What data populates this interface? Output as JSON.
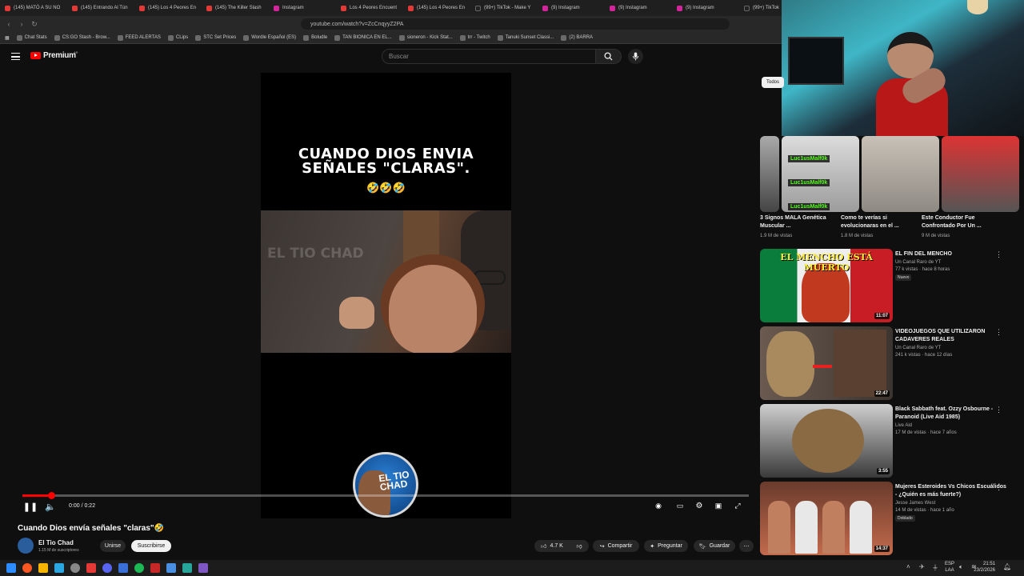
{
  "browser": {
    "tabs": [
      {
        "label": "(145) MATÓ A SU NO",
        "kind": "yt"
      },
      {
        "label": "(145) Entrando Al Tún",
        "kind": "yt"
      },
      {
        "label": "(145) Los 4 Peores En",
        "kind": "yt"
      },
      {
        "label": "(145) The Killer Slash",
        "kind": "yt"
      },
      {
        "label": "Instagram",
        "kind": "ig"
      },
      {
        "label": "Los 4 Peores Encuent",
        "kind": "yt"
      },
      {
        "label": "(145) Los 4 Peores En",
        "kind": "yt"
      },
      {
        "label": "(99+) TikTok - Make Y",
        "kind": "tt"
      },
      {
        "label": "(9) Instagram",
        "kind": "ig"
      },
      {
        "label": "(9) Instagram",
        "kind": "ig"
      },
      {
        "label": "(9) Instagram",
        "kind": "ig"
      },
      {
        "label": "(99+) TikTok",
        "kind": "tt"
      }
    ],
    "url": "youtube.com/watch?v=ZcCnqyyZ2PA",
    "bookmarks": [
      "Chat Stats",
      "CS:GO Stash - Brow...",
      "FEED ALERTAS",
      "CLips",
      "STC Set Prices",
      "Wordle Español (ES)",
      "Boludle",
      "TAN BIONICA EN EL...",
      "sioneron - Kick Stat...",
      "trr - Twitch",
      "Tanuki Sunset Classi...",
      "(2) BARRA"
    ]
  },
  "youtube": {
    "logo": "Premium",
    "logo_region": "AR",
    "search_placeholder": "Buscar",
    "chip": "Todos"
  },
  "player": {
    "caption_line1": "CUANDO DIOS ENVIA",
    "caption_line2": "SEÑALES \"CLARAS\".",
    "emojis": "🤣🤣🤣",
    "watermark": "EL TIO CHAD",
    "avatar_text": "EL TIO CHAD",
    "time": "0:00 / 0:22",
    "progress": 0.04
  },
  "video": {
    "title": "Cuando Dios envía señales \"claras\"🤣",
    "channel": "El Tio Chad",
    "subscribers": "1.15 M de suscriptores",
    "join_label": "Unirse",
    "subscribe_label": "Suscribirse",
    "likes": "4.7 K",
    "share_label": "Compartir",
    "ask_label": "Preguntar",
    "save_label": "Guardar"
  },
  "shorts": [
    {
      "title": "3 Signos MALA Genética Muscular ...",
      "views": "1.9 M de vistas"
    },
    {
      "title": "Como te verías si evolucionaras en el ...",
      "views": "1.8 M de vistas"
    },
    {
      "title": "Este Conductor Fue Confrontado Por Un ...",
      "views": "9 M de vistas"
    }
  ],
  "kick_overlay": "Luc1usMalf0k",
  "recommendations": [
    {
      "title": "EL FIN DEL MENCHO",
      "channel": "Un Canal Raro de YT",
      "meta": "77 k vistas · hace 8 horas",
      "badge": "Nuevo",
      "duration": "11:07",
      "thumb_text": "EL MENCHO ESTÁ MUERTO"
    },
    {
      "title": "VIDEOJUEGOS QUE UTILIZARON CADAVERES REALES",
      "channel": "Un Canal Raro de YT",
      "meta": "241 k vistas · hace 12 días",
      "badge": "",
      "duration": "22:47",
      "thumb_text": ""
    },
    {
      "title": "Black Sabbath feat. Ozzy Osbourne - Paranoid (Live Aid 1985)",
      "channel": "Live Aid",
      "meta": "17 M de vistas · hace 7 años",
      "badge": "",
      "duration": "3:55",
      "thumb_text": ""
    },
    {
      "title": "Mujeres Esteroides Vs Chicos Escuálidos - ¿Quién es más fuerte?)",
      "channel": "Jesse James West",
      "meta": "14 M de vistas · hace 1 año",
      "badge": "Doblado",
      "duration": "14:37",
      "thumb_text": ""
    }
  ],
  "taskbar": {
    "lang_line1": "ESP",
    "lang_line2": "LAA",
    "time": "21:51",
    "date": "23/2/2026"
  },
  "colors": {
    "accent": "#ff0000",
    "background": "#0f0f0f",
    "kick_green": "#53fc18"
  }
}
